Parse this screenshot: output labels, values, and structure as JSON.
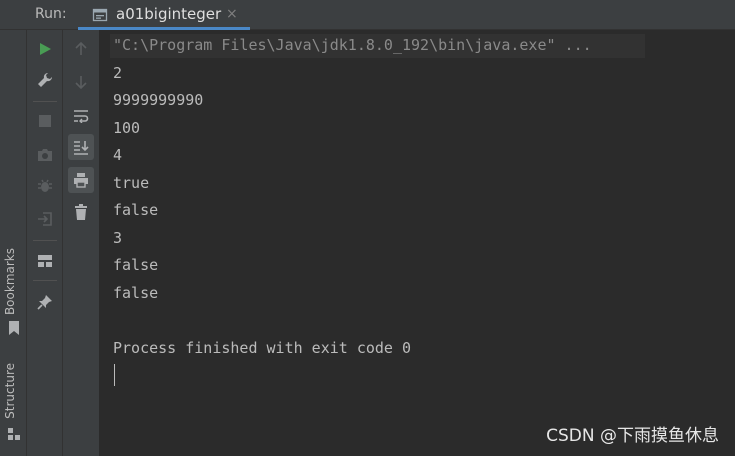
{
  "runbar": {
    "label": "Run:",
    "tab": {
      "title": "a01biginteger",
      "close": "×"
    }
  },
  "side_strip": {
    "bookmarks": "Bookmarks",
    "structure": "Structure"
  },
  "console": {
    "command": "\"C:\\Program Files\\Java\\jdk1.8.0_192\\bin\\java.exe\" ...",
    "lines": [
      "2",
      "9999999990",
      "100",
      "4",
      "true",
      "false",
      "3",
      "false",
      "false"
    ],
    "exit_message": "Process finished with exit code 0"
  },
  "watermark": "CSDN @下雨摸鱼休息",
  "colors": {
    "accent": "#4a88c7",
    "run_green": "#499c54",
    "background": "#2b2b2b",
    "panel": "#3c3f41"
  },
  "icons": {
    "col1": [
      "run-icon",
      "wrench-icon",
      "stop-icon",
      "camera-icon",
      "bug-icon",
      "login-icon",
      "layout-icon",
      "pin-icon"
    ],
    "col2": [
      "arrow-up-icon",
      "arrow-down-icon",
      "soft-wrap-icon",
      "scroll-to-end-icon",
      "print-icon",
      "trash-icon"
    ]
  }
}
